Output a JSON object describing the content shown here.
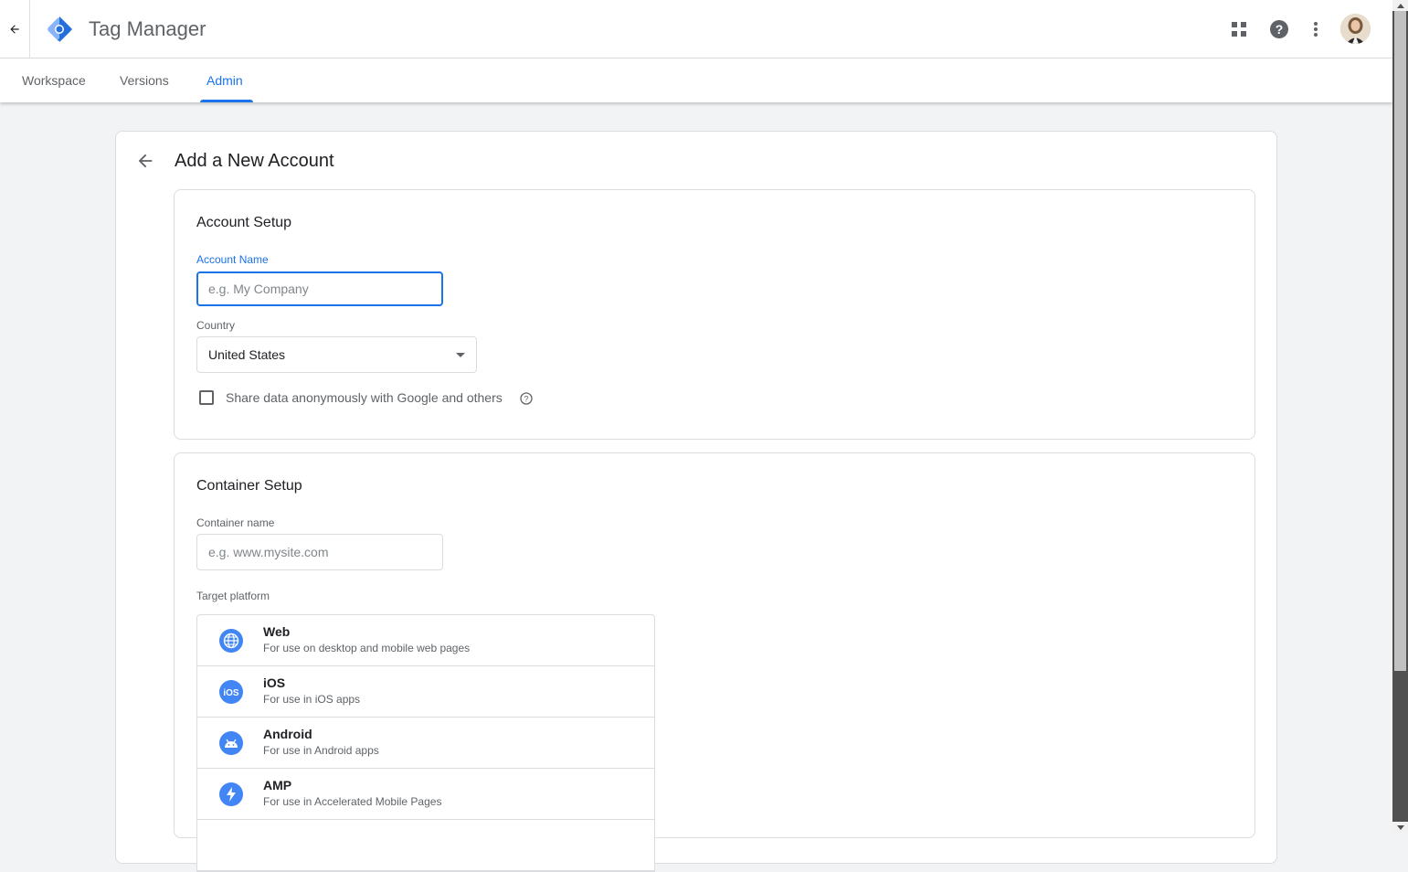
{
  "app": {
    "title": "Tag Manager"
  },
  "tabs": [
    {
      "label": "Workspace"
    },
    {
      "label": "Versions"
    },
    {
      "label": "Admin",
      "active": true
    }
  ],
  "page": {
    "title": "Add a New Account"
  },
  "account_setup": {
    "title": "Account Setup",
    "account_name_label": "Account Name",
    "account_name_placeholder": "e.g. My Company",
    "account_name_value": "",
    "country_label": "Country",
    "country_value": "United States",
    "share_data_label": "Share data anonymously with Google and others",
    "share_data_checked": false
  },
  "container_setup": {
    "title": "Container Setup",
    "container_name_label": "Container name",
    "container_name_placeholder": "e.g. www.mysite.com",
    "target_platform_label": "Target platform",
    "platforms": [
      {
        "name": "Web",
        "description": "For use on desktop and mobile web pages",
        "icon": "globe-icon"
      },
      {
        "name": "iOS",
        "description": "For use in iOS apps",
        "icon": "ios-icon"
      },
      {
        "name": "Android",
        "description": "For use in Android apps",
        "icon": "android-icon"
      },
      {
        "name": "AMP",
        "description": "For use in Accelerated Mobile Pages",
        "icon": "amp-bolt-icon"
      }
    ]
  },
  "colors": {
    "accent": "#1a73e8",
    "platform_icon": "#4285f4",
    "logo_dark": "#246fdb",
    "logo_light": "#8ab4f8"
  }
}
